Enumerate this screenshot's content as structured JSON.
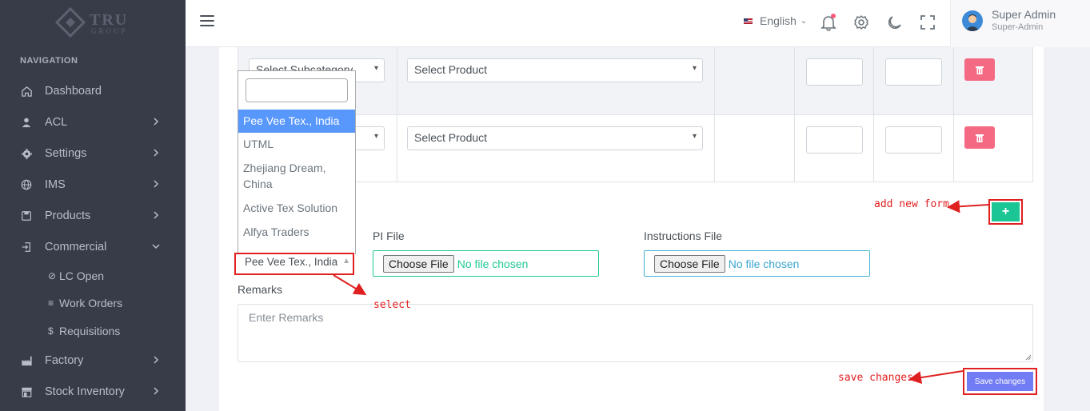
{
  "brand": {
    "logo_text": "TRU",
    "logo_sub": "GROUP"
  },
  "sidebar": {
    "section_title": "NAVIGATION",
    "items": [
      {
        "label": "Dashboard",
        "icon": "home-icon"
      },
      {
        "label": "ACL",
        "icon": "user-icon"
      },
      {
        "label": "Settings",
        "icon": "gear-icon"
      },
      {
        "label": "IMS",
        "icon": "globe-icon"
      },
      {
        "label": "Products",
        "icon": "box-icon"
      },
      {
        "label": "Commercial",
        "icon": "sign-in-icon"
      },
      {
        "label": "Factory",
        "icon": "factory-icon"
      },
      {
        "label": "Stock Inventory",
        "icon": "store-icon"
      }
    ],
    "sub_items": [
      {
        "label": "LC Open",
        "icon": "paperclip-icon"
      },
      {
        "label": "Work Orders",
        "icon": "lines-icon"
      },
      {
        "label": "Requisitions",
        "icon": "dollar-icon"
      }
    ]
  },
  "header": {
    "language": "English",
    "user_name": "Super Admin",
    "user_role": "Super-Admin"
  },
  "table": {
    "subcategory_placeholder": "Select Subcategory",
    "product_placeholder": "Select Product",
    "product_placeholder_2": "Select Product"
  },
  "dropdown": {
    "options": [
      "Pee Vee Tex., India",
      "UTML",
      "Zhejiang Dream,",
      "China",
      "Active Tex Solution",
      "Alfya Traders"
    ],
    "selected": "Pee Vee Tex., India"
  },
  "form": {
    "pi_file_label": "PI File",
    "instructions_file_label": "Instructions File",
    "choose_file": "Choose File",
    "no_file": "No file chosen",
    "remarks_label": "Remarks",
    "remarks_placeholder": "Enter Remarks",
    "add_label": "+",
    "save_label": "Save changes"
  },
  "annotations": {
    "add_new_form": "add new form",
    "select": "select",
    "save_changes": "save changes"
  },
  "colors": {
    "annotation": "#e02020",
    "sidebar": "#373c48",
    "add_button": "#1bc594",
    "save_button": "#727cf5",
    "delete_button": "#f46a83"
  }
}
